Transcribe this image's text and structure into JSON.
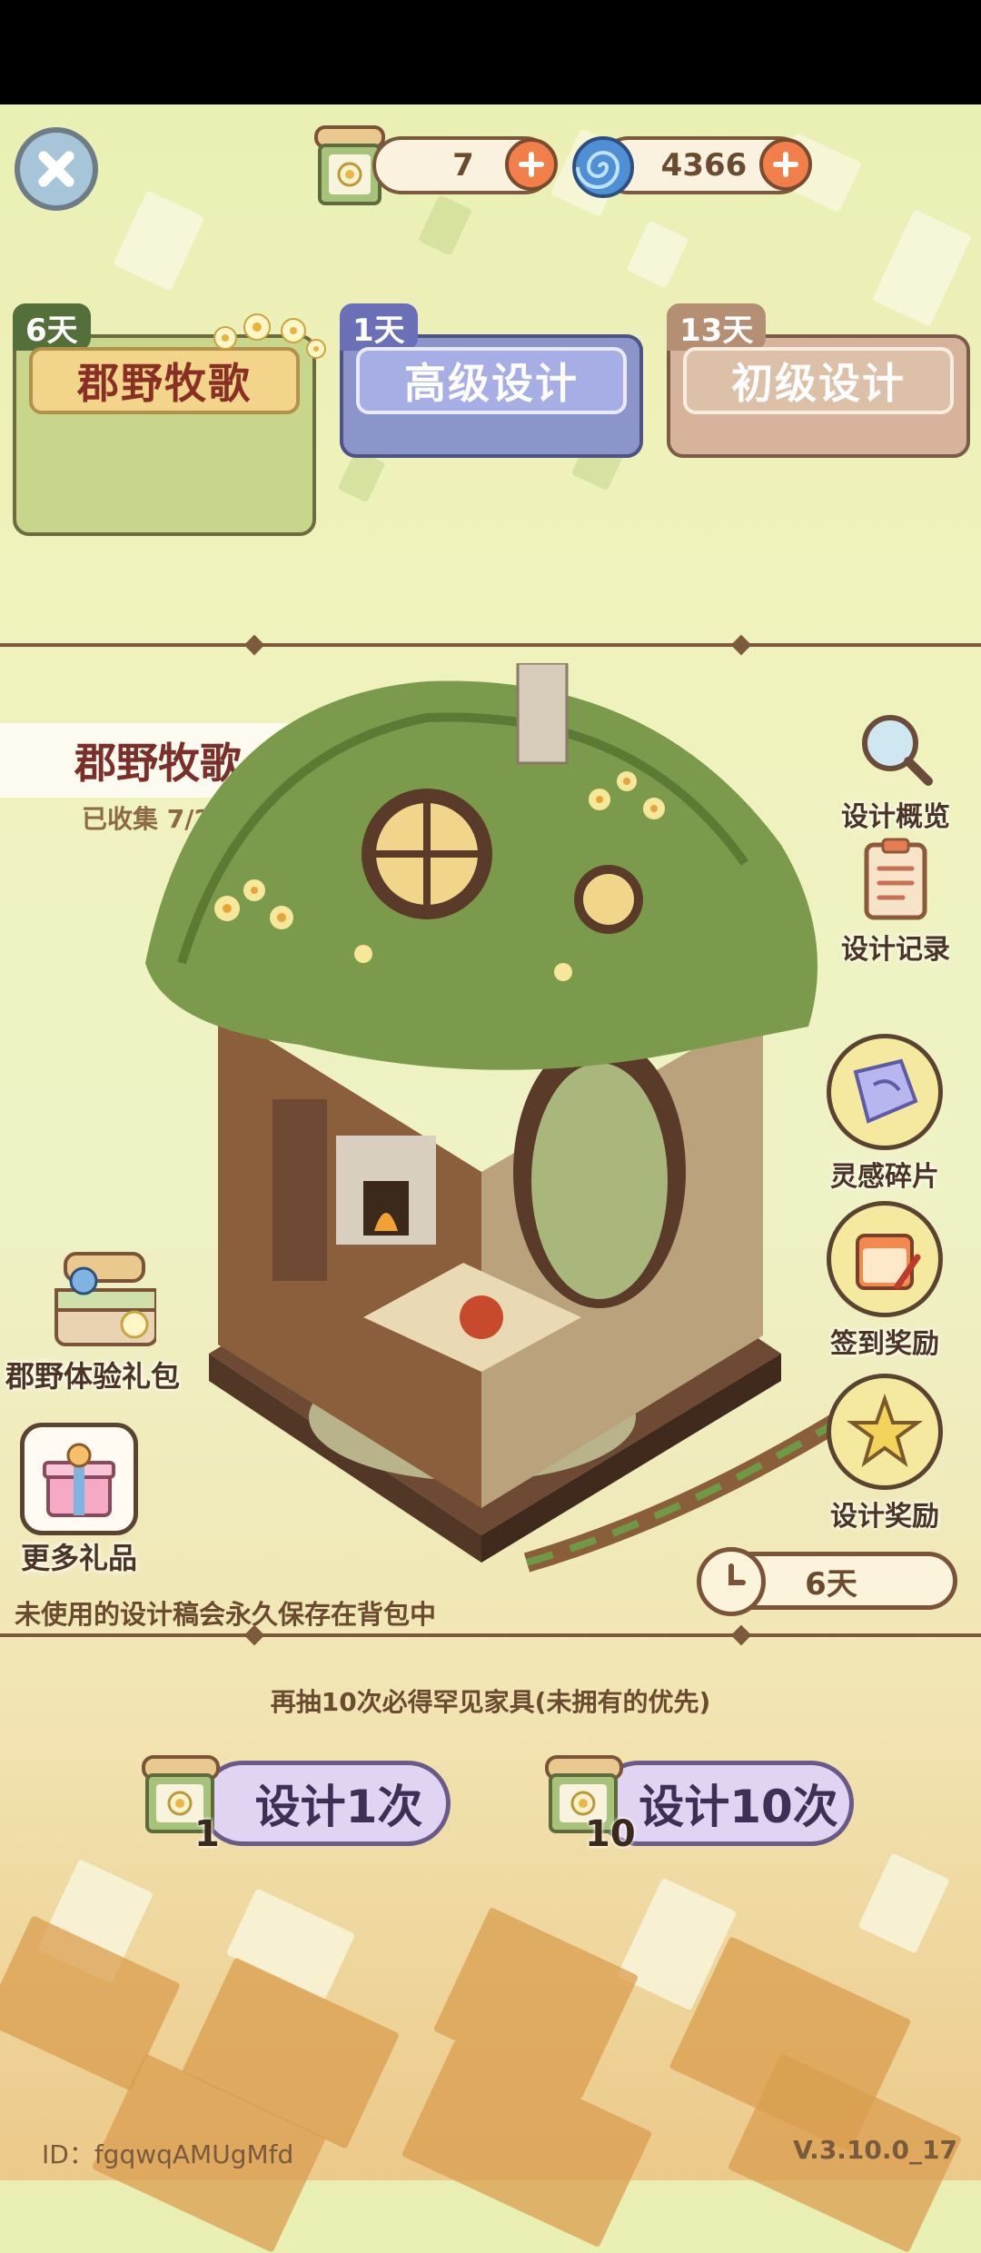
{
  "currencies": [
    {
      "name": "design-draft",
      "value": "7"
    },
    {
      "name": "inspiration-swirl",
      "value": "4366"
    }
  ],
  "tabs": [
    {
      "days": "6天",
      "label": "郡野牧歌",
      "active": true
    },
    {
      "days": "1天",
      "label": "高级设计",
      "active": false
    },
    {
      "days": "13天",
      "label": "初级设计",
      "active": false
    }
  ],
  "banner": {
    "title": "郡野牧歌",
    "collected": "已收集 7/21"
  },
  "side_menu": [
    {
      "label": "设计概览",
      "icon": "magnifier-icon"
    },
    {
      "label": "设计记录",
      "icon": "clipboard-icon"
    },
    {
      "label": "灵感碎片",
      "icon": "map-fragment-icon"
    },
    {
      "label": "签到奖励",
      "icon": "calendar-icon"
    },
    {
      "label": "设计奖励",
      "icon": "star-flower-icon"
    }
  ],
  "gifts": [
    {
      "label": "郡野体验礼包"
    },
    {
      "label": "更多礼品"
    }
  ],
  "timer": "6天",
  "note": "未使用的设计稿会永久保存在背包中",
  "hint": "再抽10次必得罕见家具(未拥有的优先)",
  "draw_buttons": [
    {
      "label": "设计1次",
      "cost": "1"
    },
    {
      "label": "设计10次",
      "cost": "10"
    }
  ],
  "footer": {
    "id": "ID：fgqwqAMUgMfd",
    "version": "V.3.10.0_17"
  },
  "colors": {
    "accent_brown": "#7d5a3c",
    "tab_green": "#b7c97a",
    "tab_blue": "#9aa5df",
    "tab_tan": "#d6b39a",
    "draw_button": "#e1d4f3",
    "plus_orange": "#f07f4a"
  }
}
